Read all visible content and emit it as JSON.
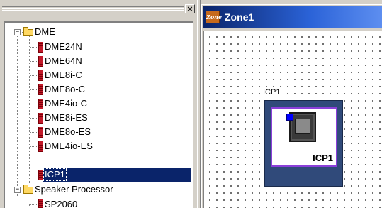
{
  "left_panel": {
    "close_label": "×",
    "tree": [
      {
        "label": "DME",
        "type": "folder",
        "expanded": true,
        "expander": "−"
      },
      {
        "label": "DME24N",
        "type": "device"
      },
      {
        "label": "DME64N",
        "type": "device"
      },
      {
        "label": "DME8i-C",
        "type": "device"
      },
      {
        "label": "DME8o-C",
        "type": "device"
      },
      {
        "label": "DME4io-C",
        "type": "device"
      },
      {
        "label": "DME8i-ES",
        "type": "device"
      },
      {
        "label": "DME8o-ES",
        "type": "device"
      },
      {
        "label": "DME4io-ES",
        "type": "device"
      },
      {
        "label": "ICP1",
        "type": "device",
        "selected": true
      },
      {
        "label": "Speaker Processor",
        "type": "folder",
        "expanded": true,
        "expander": "−"
      },
      {
        "label": "SP2060",
        "type": "device"
      }
    ]
  },
  "zone_window": {
    "icon_text": "Zone",
    "title": "Zone1",
    "component": {
      "label": "ICP1",
      "name": "ICP1"
    }
  },
  "colors": {
    "selection": "#0a246a",
    "titlebar": "#0a246a",
    "component_fill": "#304a7a",
    "component_border": "#8b3fd9",
    "port": "#0000ff",
    "device_icon": "#c21a2a",
    "folder_icon": "#ffd964"
  }
}
